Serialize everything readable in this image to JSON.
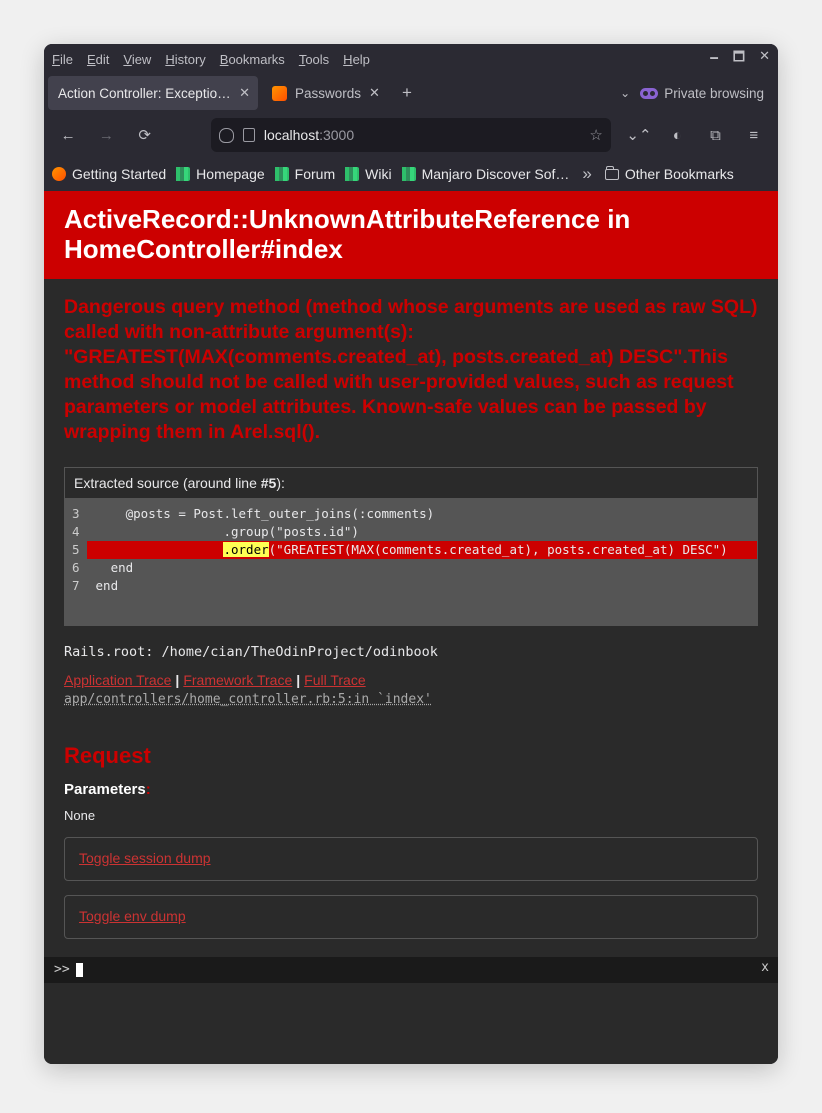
{
  "menubar": [
    "File",
    "Edit",
    "View",
    "History",
    "Bookmarks",
    "Tools",
    "Help"
  ],
  "tabs": [
    {
      "label": "Action Controller: Exception ca",
      "active": true
    },
    {
      "label": "Passwords",
      "active": false
    }
  ],
  "private_label": "Private browsing",
  "url": {
    "host": "localhost",
    "rest": ":3000"
  },
  "bookmarks": [
    "Getting Started",
    "Homepage",
    "Forum",
    "Wiki",
    "Manjaro Discover Sof…"
  ],
  "other_bookmarks": "Other Bookmarks",
  "error": {
    "title": "ActiveRecord::UnknownAttributeReference in HomeController#index",
    "message": "Dangerous query method (method whose arguments are used as raw SQL) called with non-attribute argument(s): \"GREATEST(MAX(comments.created_at), posts.created_at) DESC\".This method should not be called with user-provided values, such as request parameters or model attributes. Known-safe values can be passed by wrapping them in Arel.sql().",
    "extracted_label": "Extracted source (around line ",
    "extracted_line": "#5",
    "extracted_suffix": "):"
  },
  "code": {
    "start": 3,
    "lines": [
      "    @posts = Post.left_outer_joins(:comments)",
      "                 .group(\"posts.id\")",
      "                 .order(\"GREATEST(MAX(comments.created_at), posts.created_at) DESC\")",
      "  end",
      "end"
    ],
    "highlight_index": 2,
    "hl_prefix": "                 ",
    "hl_token": ".order",
    "hl_suffix": "(\"GREATEST(MAX(comments.created_at), posts.created_at) DESC\")"
  },
  "rails_root": "Rails.root: /home/cian/TheOdinProject/odinbook",
  "trace_links": [
    "Application Trace",
    "Framework Trace",
    "Full Trace"
  ],
  "frame": "app/controllers/home_controller.rb:5:in `index'",
  "request_heading": "Request",
  "parameters_label": "Parameters",
  "parameters_value": "None",
  "toggles": [
    "Toggle session dump",
    "Toggle env dump"
  ],
  "console_prompt": ">>",
  "console_close": "x"
}
